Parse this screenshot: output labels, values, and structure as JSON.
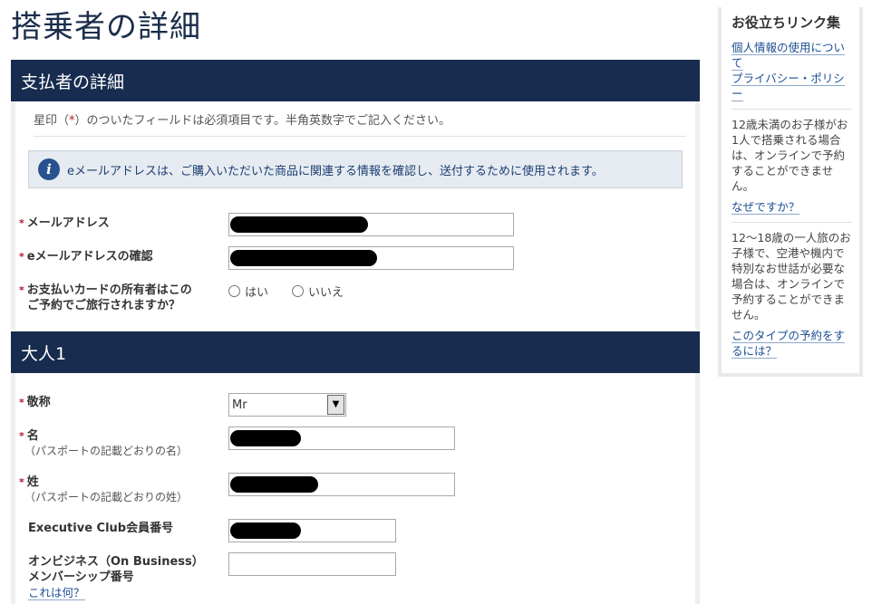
{
  "page": {
    "title": "搭乗者の詳細"
  },
  "payer": {
    "header": "支払者の詳細",
    "required_note_prefix": "星印（",
    "required_note_star": "*",
    "required_note_suffix": "）のついたフィールドは必須項目です。半角英数字でご記入ください。",
    "info_text": "eメールアドレスは、ご購入いただいた商品に関連する情報を確認し、送付するために使用されます。",
    "email_label": "メールアドレス",
    "email_confirm_label": "eメールアドレスの確認",
    "cardholder_label_line1": "お支払いカードの所有者はこの",
    "cardholder_label_line2": "ご予約でご旅行されますか？",
    "radio_yes": "はい",
    "radio_no": "いいえ",
    "required_marker": "*"
  },
  "adult": {
    "header": "大人1",
    "title_label": "敬称",
    "title_value": "Mr",
    "first_name_label": "名",
    "first_name_sub": "（パスポートの記載どおりの名）",
    "last_name_label": "姓",
    "last_name_sub": "（パスポートの記載どおりの姓）",
    "exec_club_label": "Executive Club会員番号",
    "onbusiness_label_line1": "オンビジネス（On Business）",
    "onbusiness_label_line2": "メンバーシップ番号",
    "whats_this_link": "これは何？",
    "required_marker": "*"
  },
  "sidebar": {
    "title": "お役立ちリンク集",
    "privacy_link": "個人情報の使用について\nプライバシー・ポリシー",
    "under12_text": "12歳未満のお子様がお1人で搭乗される場合は、オンラインで予約することができません。",
    "why_link": "なぜですか？",
    "teen_text": "12～18歳の一人旅のお子様で、空港や機内で特別なお世話が必要な場合は、オンラインで予約することができません。",
    "how_link": "このタイプの予約をするには？"
  },
  "icons": {
    "info": "info-icon",
    "dropdown": "chevron-down-icon"
  },
  "colors": {
    "header_bg": "#172c4e",
    "required": "#b4162b",
    "link": "#1b4f93"
  }
}
